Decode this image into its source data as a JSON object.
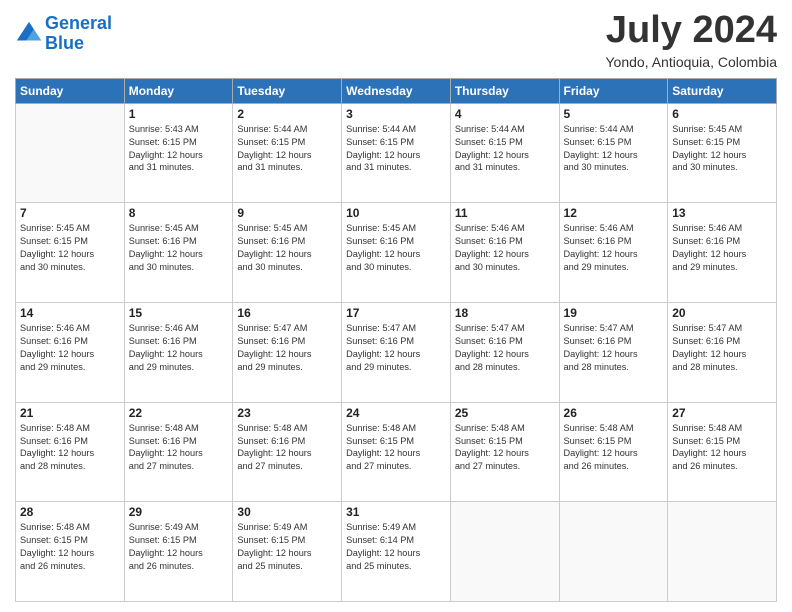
{
  "header": {
    "logo_line1": "General",
    "logo_line2": "Blue",
    "month_title": "July 2024",
    "location": "Yondo, Antioquia, Colombia"
  },
  "weekdays": [
    "Sunday",
    "Monday",
    "Tuesday",
    "Wednesday",
    "Thursday",
    "Friday",
    "Saturday"
  ],
  "weeks": [
    [
      {
        "day": "",
        "info": ""
      },
      {
        "day": "1",
        "info": "Sunrise: 5:43 AM\nSunset: 6:15 PM\nDaylight: 12 hours\nand 31 minutes."
      },
      {
        "day": "2",
        "info": "Sunrise: 5:44 AM\nSunset: 6:15 PM\nDaylight: 12 hours\nand 31 minutes."
      },
      {
        "day": "3",
        "info": "Sunrise: 5:44 AM\nSunset: 6:15 PM\nDaylight: 12 hours\nand 31 minutes."
      },
      {
        "day": "4",
        "info": "Sunrise: 5:44 AM\nSunset: 6:15 PM\nDaylight: 12 hours\nand 31 minutes."
      },
      {
        "day": "5",
        "info": "Sunrise: 5:44 AM\nSunset: 6:15 PM\nDaylight: 12 hours\nand 30 minutes."
      },
      {
        "day": "6",
        "info": "Sunrise: 5:45 AM\nSunset: 6:15 PM\nDaylight: 12 hours\nand 30 minutes."
      }
    ],
    [
      {
        "day": "7",
        "info": "Sunrise: 5:45 AM\nSunset: 6:15 PM\nDaylight: 12 hours\nand 30 minutes."
      },
      {
        "day": "8",
        "info": "Sunrise: 5:45 AM\nSunset: 6:16 PM\nDaylight: 12 hours\nand 30 minutes."
      },
      {
        "day": "9",
        "info": "Sunrise: 5:45 AM\nSunset: 6:16 PM\nDaylight: 12 hours\nand 30 minutes."
      },
      {
        "day": "10",
        "info": "Sunrise: 5:45 AM\nSunset: 6:16 PM\nDaylight: 12 hours\nand 30 minutes."
      },
      {
        "day": "11",
        "info": "Sunrise: 5:46 AM\nSunset: 6:16 PM\nDaylight: 12 hours\nand 30 minutes."
      },
      {
        "day": "12",
        "info": "Sunrise: 5:46 AM\nSunset: 6:16 PM\nDaylight: 12 hours\nand 29 minutes."
      },
      {
        "day": "13",
        "info": "Sunrise: 5:46 AM\nSunset: 6:16 PM\nDaylight: 12 hours\nand 29 minutes."
      }
    ],
    [
      {
        "day": "14",
        "info": "Sunrise: 5:46 AM\nSunset: 6:16 PM\nDaylight: 12 hours\nand 29 minutes."
      },
      {
        "day": "15",
        "info": "Sunrise: 5:46 AM\nSunset: 6:16 PM\nDaylight: 12 hours\nand 29 minutes."
      },
      {
        "day": "16",
        "info": "Sunrise: 5:47 AM\nSunset: 6:16 PM\nDaylight: 12 hours\nand 29 minutes."
      },
      {
        "day": "17",
        "info": "Sunrise: 5:47 AM\nSunset: 6:16 PM\nDaylight: 12 hours\nand 29 minutes."
      },
      {
        "day": "18",
        "info": "Sunrise: 5:47 AM\nSunset: 6:16 PM\nDaylight: 12 hours\nand 28 minutes."
      },
      {
        "day": "19",
        "info": "Sunrise: 5:47 AM\nSunset: 6:16 PM\nDaylight: 12 hours\nand 28 minutes."
      },
      {
        "day": "20",
        "info": "Sunrise: 5:47 AM\nSunset: 6:16 PM\nDaylight: 12 hours\nand 28 minutes."
      }
    ],
    [
      {
        "day": "21",
        "info": "Sunrise: 5:48 AM\nSunset: 6:16 PM\nDaylight: 12 hours\nand 28 minutes."
      },
      {
        "day": "22",
        "info": "Sunrise: 5:48 AM\nSunset: 6:16 PM\nDaylight: 12 hours\nand 27 minutes."
      },
      {
        "day": "23",
        "info": "Sunrise: 5:48 AM\nSunset: 6:16 PM\nDaylight: 12 hours\nand 27 minutes."
      },
      {
        "day": "24",
        "info": "Sunrise: 5:48 AM\nSunset: 6:15 PM\nDaylight: 12 hours\nand 27 minutes."
      },
      {
        "day": "25",
        "info": "Sunrise: 5:48 AM\nSunset: 6:15 PM\nDaylight: 12 hours\nand 27 minutes."
      },
      {
        "day": "26",
        "info": "Sunrise: 5:48 AM\nSunset: 6:15 PM\nDaylight: 12 hours\nand 26 minutes."
      },
      {
        "day": "27",
        "info": "Sunrise: 5:48 AM\nSunset: 6:15 PM\nDaylight: 12 hours\nand 26 minutes."
      }
    ],
    [
      {
        "day": "28",
        "info": "Sunrise: 5:48 AM\nSunset: 6:15 PM\nDaylight: 12 hours\nand 26 minutes."
      },
      {
        "day": "29",
        "info": "Sunrise: 5:49 AM\nSunset: 6:15 PM\nDaylight: 12 hours\nand 26 minutes."
      },
      {
        "day": "30",
        "info": "Sunrise: 5:49 AM\nSunset: 6:15 PM\nDaylight: 12 hours\nand 25 minutes."
      },
      {
        "day": "31",
        "info": "Sunrise: 5:49 AM\nSunset: 6:14 PM\nDaylight: 12 hours\nand 25 minutes."
      },
      {
        "day": "",
        "info": ""
      },
      {
        "day": "",
        "info": ""
      },
      {
        "day": "",
        "info": ""
      }
    ]
  ]
}
